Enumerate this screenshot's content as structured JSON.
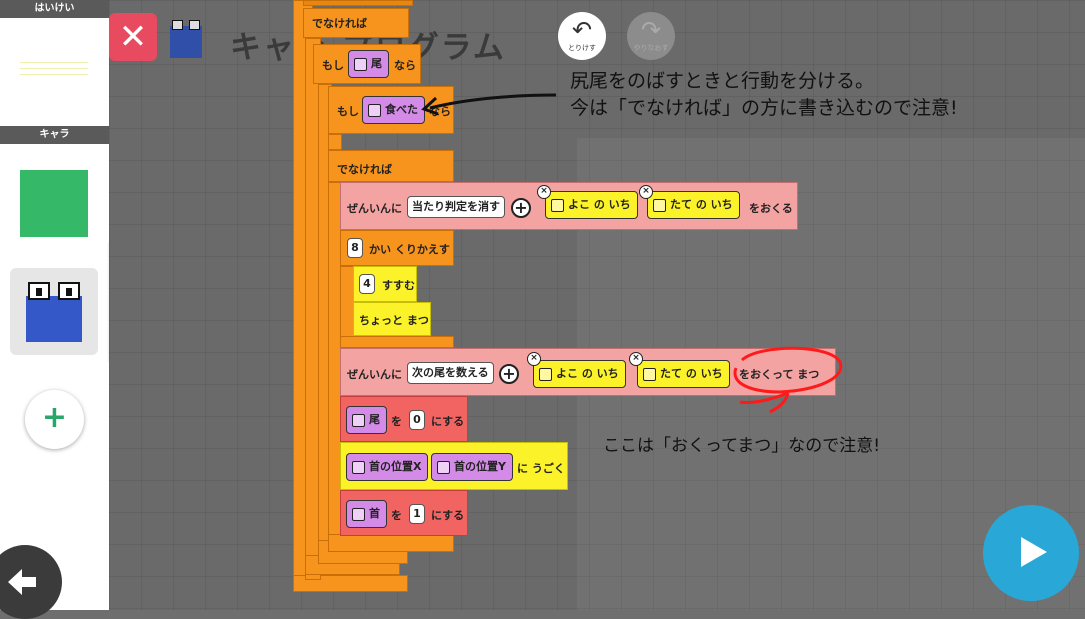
{
  "sidebar": {
    "background_header": "はいけい",
    "chara_header": "キャラ",
    "add_button": "+"
  },
  "header": {
    "close": "✕",
    "title": "キャラ プログラム",
    "undo_label": "とりけす",
    "redo_label": "やりなおす"
  },
  "blocks": {
    "else_top": "でなければ",
    "if1": "もし",
    "if1_var": "尾",
    "if1_then": "なら",
    "if2": "もし",
    "if2_var": "食べた",
    "if2_then": "なら",
    "else2": "でなければ",
    "send1": {
      "prefix": "ぜんいんに",
      "message": "当たり判定を消す",
      "var_x": "よこ の いち",
      "var_y": "たて の いち",
      "suffix": "をおくる"
    },
    "repeat": {
      "count": "8",
      "label": "かい くりかえす"
    },
    "move": {
      "count": "4",
      "label": "すすむ"
    },
    "wait": "ちょっと まつ",
    "send2": {
      "prefix": "ぜんいんに",
      "message": "次の尾を数える",
      "var_x": "よこ の いち",
      "var_y": "たて の いち",
      "suffix": "をおくって まつ"
    },
    "set1": {
      "var": "尾",
      "to": "を",
      "value": "0",
      "suffix": "にする"
    },
    "moveto": {
      "var_x": "首の位置X",
      "var_y": "首の位置Y",
      "suffix": "に うごく"
    },
    "set2": {
      "var": "首",
      "to": "を",
      "value": "1",
      "suffix": "にする"
    }
  },
  "annotations": {
    "note1_line1": "尻尾をのばすときと行動を分ける。",
    "note1_line2": "今は「でなければ」の方に書き込むので注意!",
    "note2": "ここは「おくってまつ」なので注意!"
  },
  "colors": {
    "control": "#f7941d",
    "message": "#f4a3a3",
    "motion": "#fbf22a",
    "variable": "#f26462",
    "play": "#29a8d8",
    "close": "#e84a5f",
    "annotation_red": "#ff0000"
  }
}
